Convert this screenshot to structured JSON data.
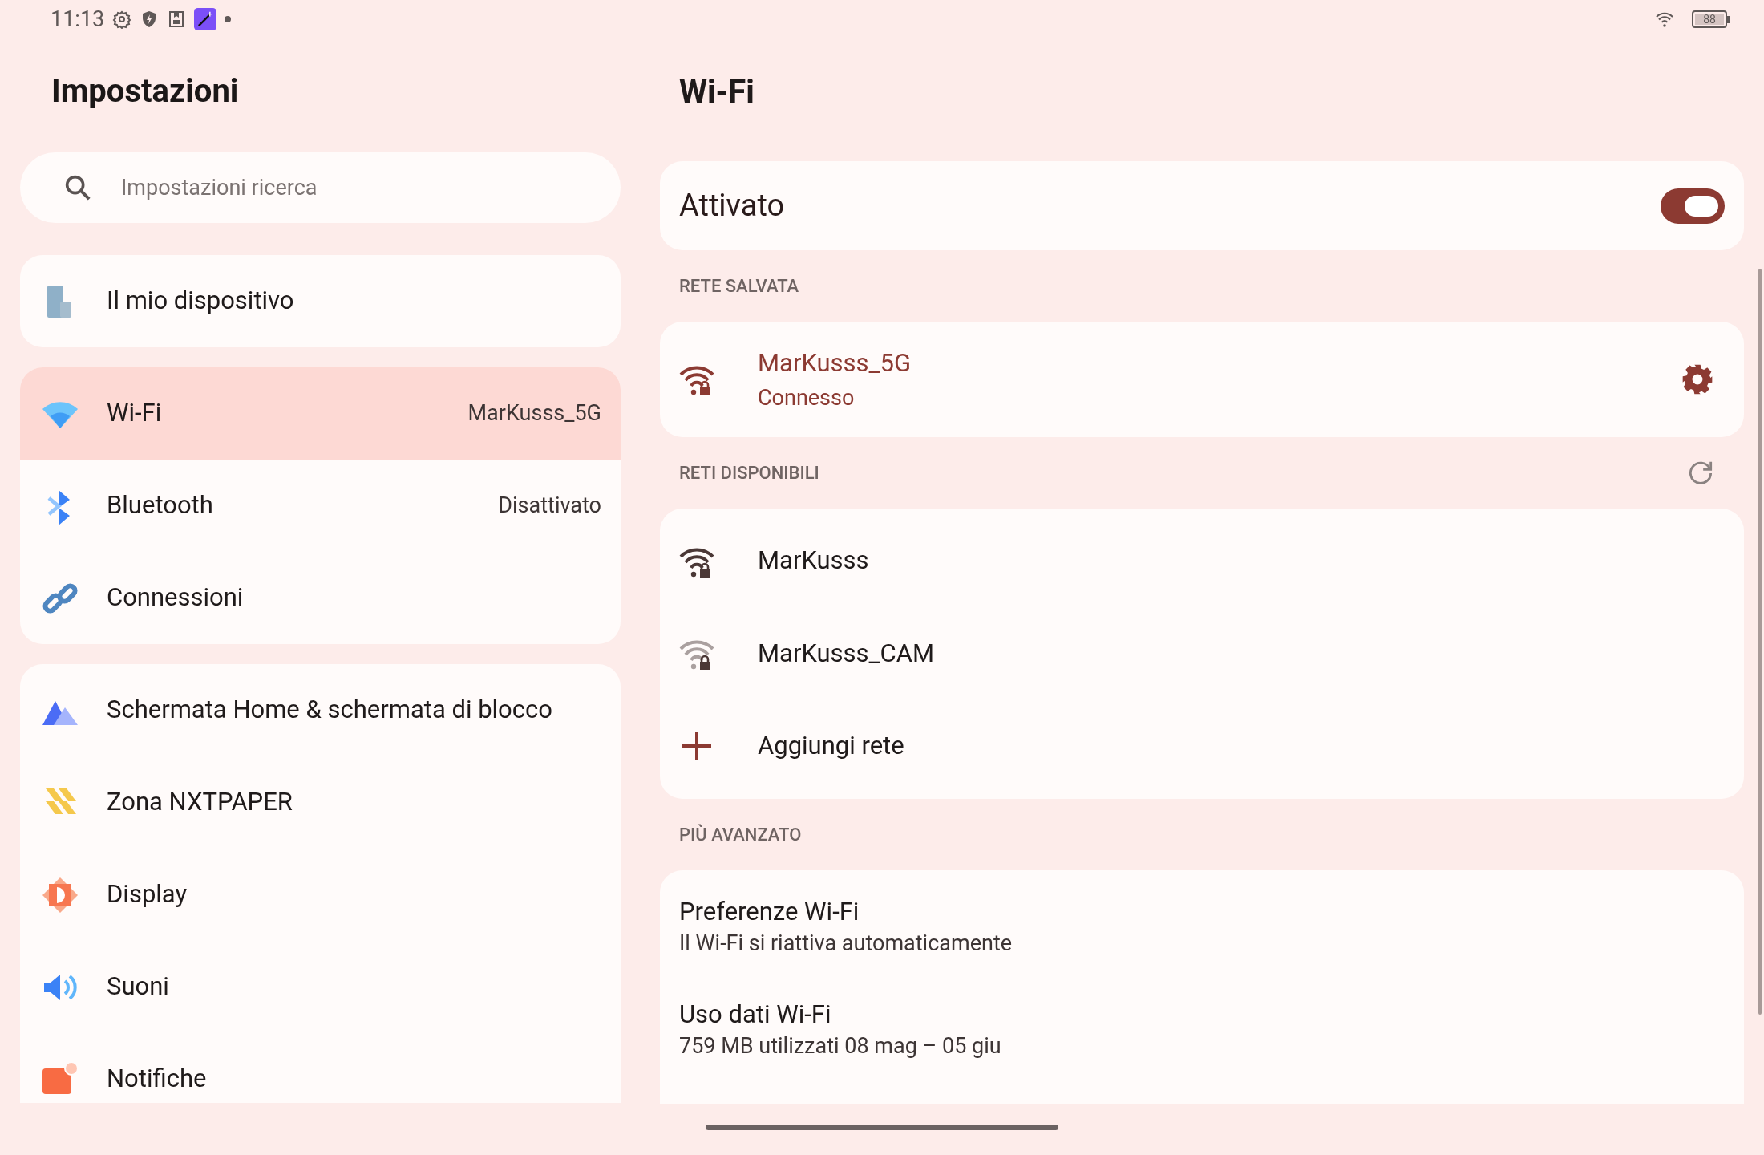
{
  "status_bar": {
    "time": "11:13",
    "battery": "88"
  },
  "settings": {
    "title": "Impostazioni",
    "search": {
      "placeholder": "Impostazioni ricerca"
    },
    "groups": [
      [
        {
          "kind": "device",
          "label": "Il mio dispositivo",
          "selected": false
        }
      ],
      [
        {
          "kind": "wifi",
          "label": "Wi-Fi",
          "value": "MarKusss_5G",
          "selected": true
        },
        {
          "kind": "bluetooth",
          "label": "Bluetooth",
          "value": "Disattivato",
          "selected": false
        },
        {
          "kind": "link",
          "label": "Connessioni",
          "selected": false
        }
      ],
      [
        {
          "kind": "home",
          "label": "Schermata Home & schermata di blocco",
          "selected": false
        },
        {
          "kind": "nxtpaper",
          "label": "Zona NXTPAPER",
          "selected": false
        },
        {
          "kind": "display",
          "label": "Display",
          "selected": false
        },
        {
          "kind": "sound",
          "label": "Suoni",
          "selected": false
        },
        {
          "kind": "notification",
          "label": "Notifiche",
          "selected": false
        }
      ]
    ]
  },
  "wifi": {
    "title": "Wi-Fi",
    "toggle": {
      "label": "Attivato",
      "on": true
    },
    "saved_header": "RETE SALVATA",
    "saved": {
      "name": "MarKusss_5G",
      "status": "Connesso"
    },
    "available_header": "RETI DISPONIBILI",
    "available": [
      {
        "kind": "strong",
        "name": "MarKusss"
      },
      {
        "kind": "weak",
        "name": "MarKusss_CAM"
      },
      {
        "kind": "add",
        "name": "Aggiungi rete"
      }
    ],
    "advanced_header": "PIÙ AVANZATO",
    "advanced": [
      {
        "title": "Preferenze Wi-Fi",
        "subtitle": "Il Wi-Fi si riattiva automaticamente"
      },
      {
        "title": "Uso dati Wi-Fi",
        "subtitle": "759 MB utilizzati 08 mag – 05 giu"
      }
    ]
  }
}
